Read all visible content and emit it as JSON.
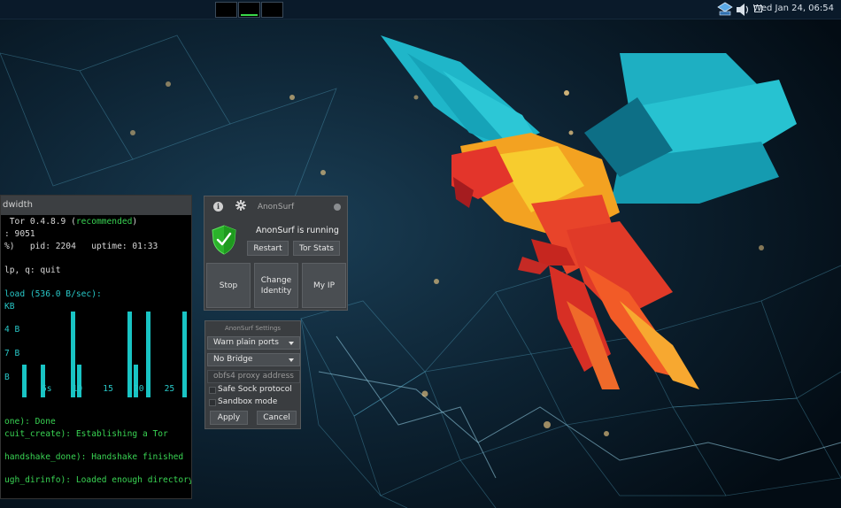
{
  "panel": {
    "clock": "Wed Jan 24, 06:54"
  },
  "terminal": {
    "title": "dwidth",
    "lines": [
      " Tor 0.4.8.9 (",
      "recommended",
      ")",
      ": 9051",
      "%)   pid: 2204   uptime: 01:33",
      "lp, q: quit",
      "load (536.0 B/sec):",
      "KB",
      "4 B",
      "7 B",
      "B",
      "5s    10    15    20    25",
      "one): Done",
      "cuit_create): Establishing a Tor",
      "handshake_done): Handshake finished",
      "ugh_dirinfo): Loaded enough directory"
    ],
    "bars": [
      0.35,
      0.35,
      0.91,
      0.35,
      0.91,
      0.35,
      0.91,
      0.91
    ]
  },
  "anonsurf": {
    "title": "AnonSurf",
    "status": "AnonSurf is running",
    "restart": "Restart",
    "tor_stats": "Tor Stats",
    "stop": "Stop",
    "change_identity_1": "Change",
    "change_identity_2": "Identity",
    "my_ip": "My IP"
  },
  "settings": {
    "title": "AnonSurf Settings",
    "warn_ports": "Warn plain ports",
    "bridge": "No Bridge",
    "proxy_placeholder": "obfs4 proxy address",
    "safe_sock": "Safe Sock protocol",
    "sandbox": "Sandbox mode",
    "apply": "Apply",
    "cancel": "Cancel"
  },
  "colors": {
    "panel": "#0a1a2a",
    "bars": "#19c4c4",
    "term_green": "#39d353",
    "shield": "#2bb32b"
  }
}
